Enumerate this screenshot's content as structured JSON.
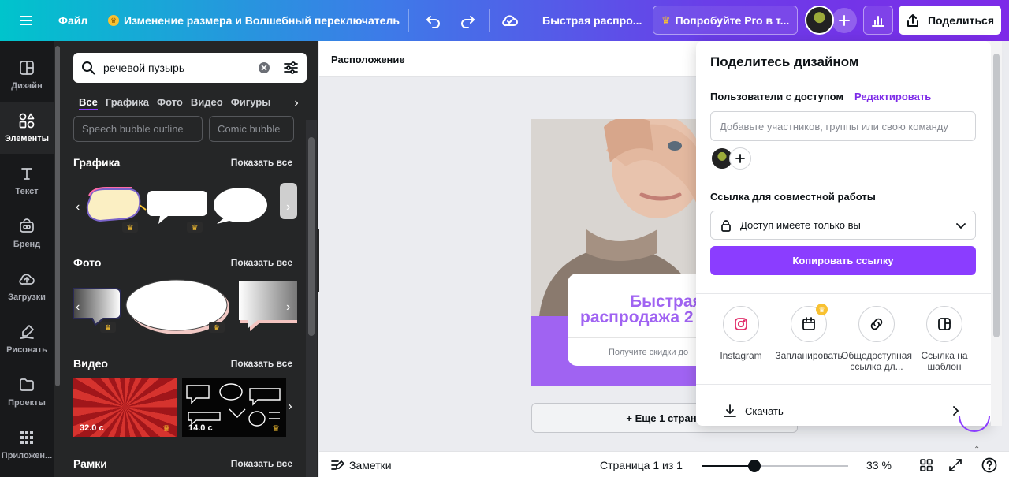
{
  "topbar": {
    "file_label": "Файл",
    "feature_label": "Изменение размера и Волшебный переключатель",
    "design_title": "Быстрая распро...",
    "pro_label": "Попробуйте Pro в т...",
    "share_label": "Поделиться"
  },
  "rail": {
    "items": [
      {
        "label": "Дизайн",
        "icon": "layout-icon"
      },
      {
        "label": "Элементы",
        "icon": "shapes-icon"
      },
      {
        "label": "Текст",
        "icon": "text-icon"
      },
      {
        "label": "Бренд",
        "icon": "brand-icon"
      },
      {
        "label": "Загрузки",
        "icon": "upload-cloud-icon"
      },
      {
        "label": "Рисовать",
        "icon": "draw-icon"
      },
      {
        "label": "Проекты",
        "icon": "folder-icon"
      },
      {
        "label": "Приложен...",
        "icon": "apps-grid-icon"
      }
    ]
  },
  "panel": {
    "search_value": "речевой пузырь",
    "tabs": [
      "Все",
      "Графика",
      "Фото",
      "Видео",
      "Фигуры"
    ],
    "chips": [
      "Speech bubble outline",
      "Comic bubble"
    ],
    "sections": {
      "graphics": "Графика",
      "photos": "Фото",
      "videos": "Видео",
      "frames": "Рамки"
    },
    "show_all": "Показать все",
    "video_durations": [
      "32.0 с",
      "14.0 с"
    ]
  },
  "canvas": {
    "header": "Расположение",
    "design_headline_1": "Быстрая",
    "design_headline_2": "распродажа 2",
    "design_subtext": "Получите скидки до",
    "add_page": "+ Еще 1 страни"
  },
  "bottombar": {
    "notes": "Заметки",
    "page_indicator": "Страница 1 из 1",
    "zoom": "33 %",
    "zoom_fraction": 0.36
  },
  "share": {
    "title": "Поделитесь дизайном",
    "people_label": "Пользователи с доступом",
    "edit_link": "Редактировать",
    "invite_placeholder": "Добавьте участников, группы или свою команду",
    "collab_label": "Ссылка для совместной работы",
    "access_value": "Доступ имеете только вы",
    "copy_button": "Копировать ссылку",
    "options": [
      {
        "label": "Instagram",
        "icon": "instagram-icon"
      },
      {
        "label": "Запланировать",
        "icon": "calendar-icon"
      },
      {
        "label": "Общедоступная ссылка дл...",
        "icon": "link-icon"
      },
      {
        "label": "Ссылка на шаблон",
        "icon": "template-icon"
      }
    ],
    "download": "Скачать"
  },
  "colors": {
    "accent": "#8b3dff",
    "rail_bg": "#18191b",
    "panel_bg": "#252627",
    "crown": "#f8c131"
  }
}
